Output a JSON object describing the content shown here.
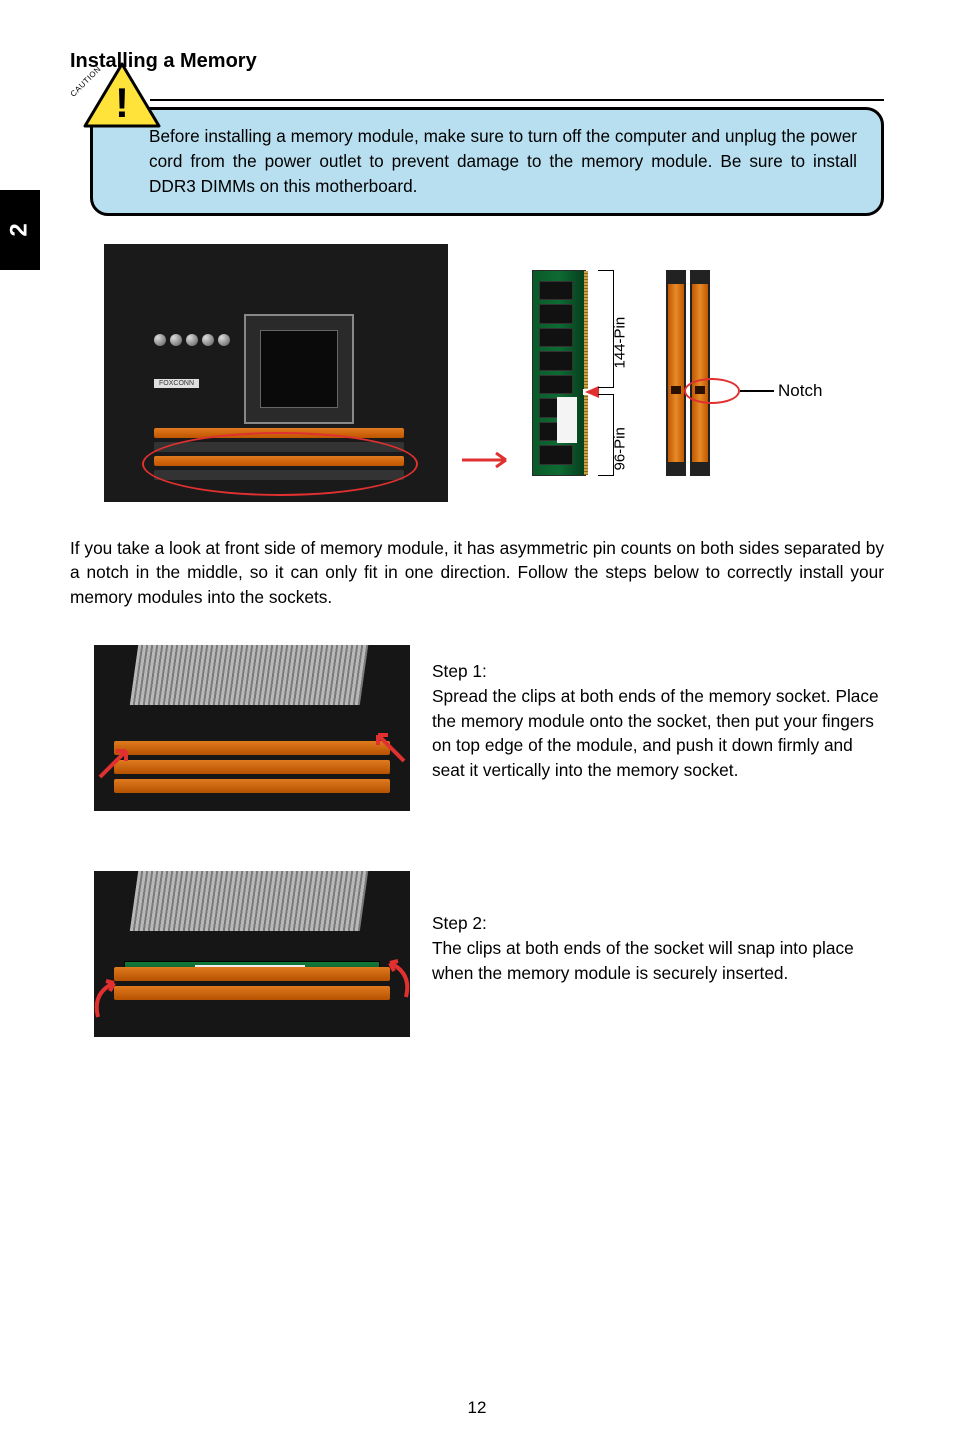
{
  "sideTab": "2",
  "title": "Installing a Memory",
  "caution": {
    "label": "CAUTION",
    "mark": "!",
    "text": "Before installing a memory module, make sure to turn off the computer and unplug the power cord from the power outlet to prevent damage to the memory module. Be sure to install DDR3 DIMMs on this motherboard."
  },
  "diagram": {
    "pinsTop": "144-Pin",
    "pinsBottom": "96-Pin",
    "notch": "Notch",
    "boardBrand": "FOXCONN"
  },
  "intro": "If you take a look at front side of memory module, it has asymmetric pin counts on both sides separated by a notch in the middle, so it can only fit in one direction. Follow the steps below to correctly install your memory modules into the sockets.",
  "step1": {
    "heading": "Step 1:",
    "text": "Spread the clips at both ends of the memory socket. Place the memory module onto the socket, then put your fingers on top edge of the module, and push it down firmly and seat it vertically into the memory socket."
  },
  "step2": {
    "heading": "Step 2:",
    "text": "The clips at both ends of the socket will snap into place when the memory module is securely inserted."
  },
  "pageNumber": "12"
}
